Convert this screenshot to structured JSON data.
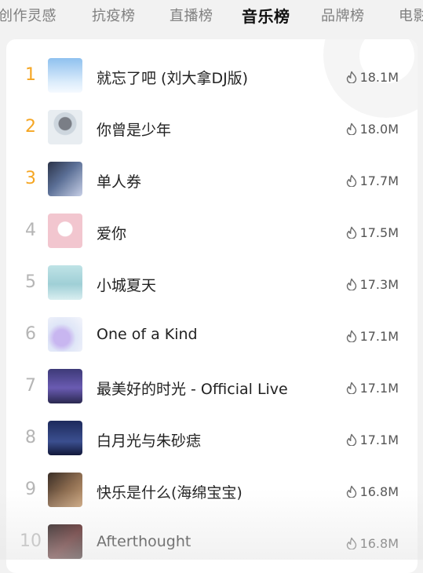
{
  "tabs": [
    "创作灵感",
    "抗疫榜",
    "直播榜",
    "音乐榜",
    "品牌榜",
    "电影"
  ],
  "active_tab": "音乐榜",
  "accent_color": "#f5a623",
  "songs": [
    {
      "rank": "1",
      "title": "就忘了吧 (刘大拿DJ版)",
      "heat": "18.1M"
    },
    {
      "rank": "2",
      "title": "你曾是少年",
      "heat": "18.0M"
    },
    {
      "rank": "3",
      "title": "单人券",
      "heat": "17.7M"
    },
    {
      "rank": "4",
      "title": "爱你",
      "heat": "17.5M"
    },
    {
      "rank": "5",
      "title": "小城夏天",
      "heat": "17.3M"
    },
    {
      "rank": "6",
      "title": "One of a Kind",
      "heat": "17.1M"
    },
    {
      "rank": "7",
      "title": "最美好的时光 - Official Live",
      "heat": "17.1M"
    },
    {
      "rank": "8",
      "title": "白月光与朱砂痣",
      "heat": "17.1M"
    },
    {
      "rank": "9",
      "title": "快乐是什么(海绵宝宝)",
      "heat": "16.8M"
    },
    {
      "rank": "10",
      "title": "Afterthought",
      "heat": "16.8M"
    }
  ]
}
